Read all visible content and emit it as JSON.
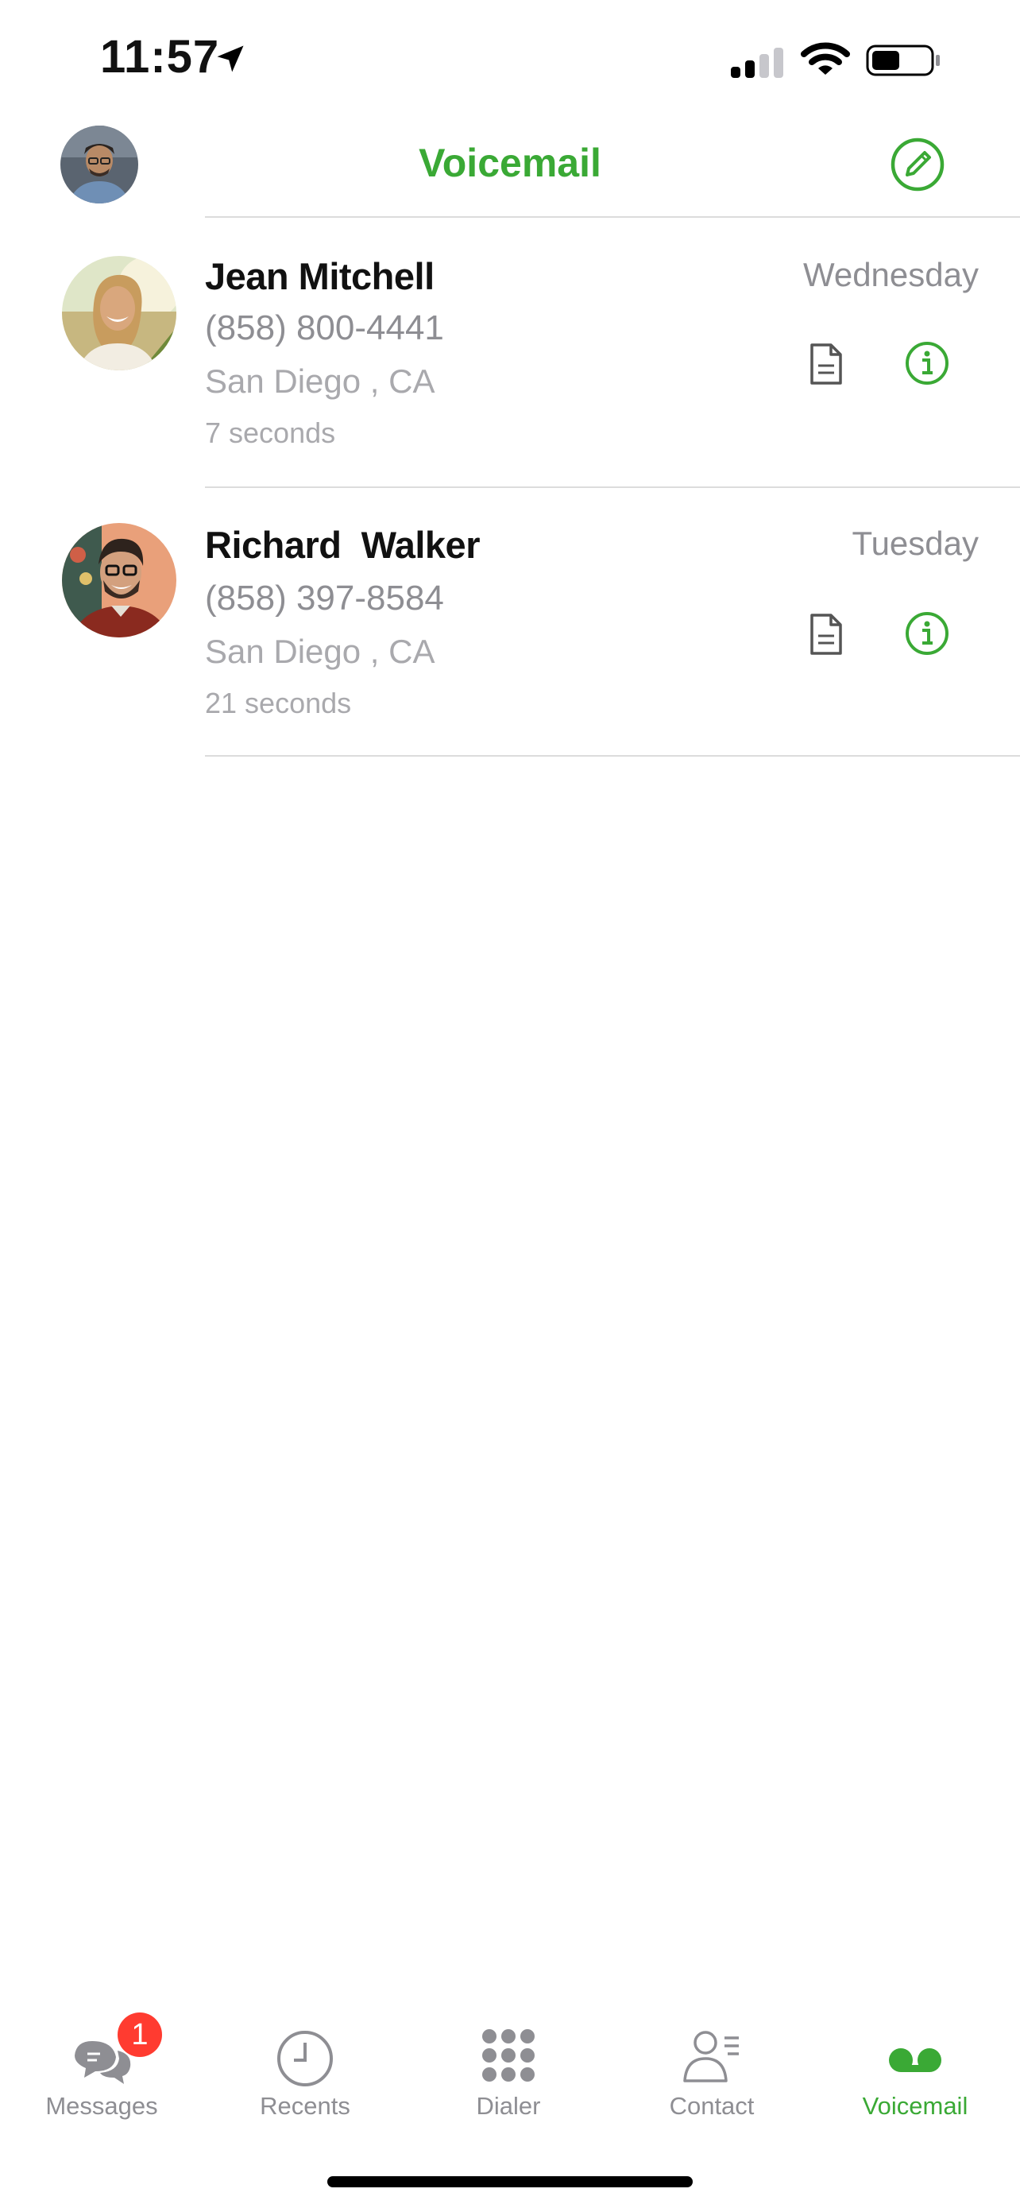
{
  "status_bar": {
    "time": "11:57"
  },
  "header": {
    "title": "Voicemail",
    "accent_color": "#3aa935",
    "compose_icon": "compose-icon"
  },
  "voicemails": [
    {
      "name": "Jean Mitchell",
      "phone": "(858) 800-4441",
      "location": "San Diego , CA",
      "duration": "7 seconds",
      "date": "Wednesday"
    },
    {
      "name": "Richard  Walker",
      "phone": "(858) 397-8584",
      "location": "San Diego , CA",
      "duration": "21 seconds",
      "date": "Tuesday"
    }
  ],
  "tab_bar": {
    "tabs": [
      {
        "label": "Messages",
        "icon": "messages-icon",
        "badge": "1"
      },
      {
        "label": "Recents",
        "icon": "clock-icon"
      },
      {
        "label": "Dialer",
        "icon": "keypad-icon"
      },
      {
        "label": "Contact",
        "icon": "contact-icon"
      },
      {
        "label": "Voicemail",
        "icon": "voicemail-icon",
        "active": true
      }
    ]
  }
}
